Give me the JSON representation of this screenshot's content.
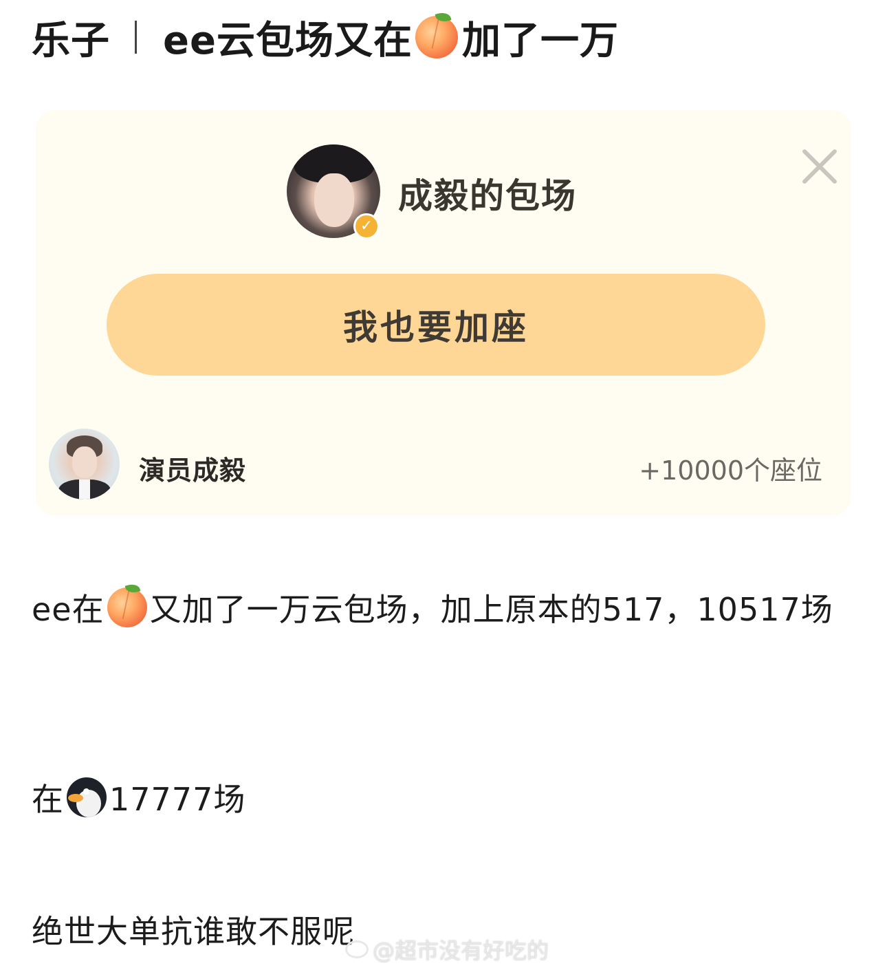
{
  "post": {
    "title_prefix": "乐子",
    "title_part1": "ee云包场又在",
    "title_part2": "加了一万",
    "title_emoji": "peach-emoji"
  },
  "card": {
    "title": "成毅的包场",
    "verified_mark": "✓",
    "join_button": "我也要加座",
    "supporter_name": "演员成毅",
    "seats_added": "+10000个座位",
    "accent_color": "#fed796",
    "background_color": "#fffdf2"
  },
  "content": {
    "p1_part1": "ee在",
    "p1_emoji": "peach-emoji",
    "p1_part2": "又加了一万云包场，加上原本的517，10517场",
    "p2_part1": "在",
    "p2_emoji": "penguin-emoji",
    "p2_part2": "17777场",
    "p3": "绝世大单抗谁敢不服呢"
  },
  "watermark": {
    "icon": "weibo-icon",
    "text": "@超市没有好吃的"
  }
}
